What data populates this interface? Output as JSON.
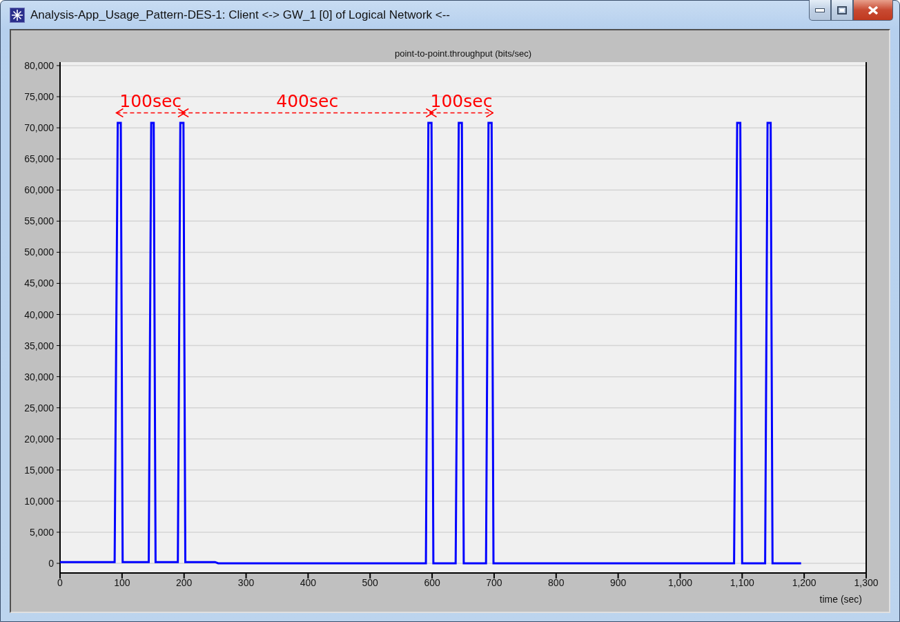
{
  "window": {
    "title": "Analysis-App_Usage_Pattern-DES-1: Client <-> GW_1 [0] of Logical Network <--"
  },
  "chart": {
    "chart_data": {
      "type": "line",
      "title": "point-to-point.throughput (bits/sec)",
      "xlabel": "time (sec)",
      "x": [
        0,
        88,
        93,
        98,
        101,
        143,
        147,
        151,
        154,
        190,
        194,
        199,
        202,
        250,
        255,
        590,
        594,
        599,
        602,
        638,
        643,
        648,
        651,
        687,
        691,
        696,
        699,
        1087,
        1092,
        1097,
        1100,
        1137,
        1141,
        1146,
        1149,
        1195
      ],
      "grid": true,
      "series": [
        {
          "color": "#0000ff",
          "values": [
            200,
            200,
            70800,
            70800,
            200,
            200,
            70800,
            70800,
            200,
            200,
            70800,
            70800,
            200,
            200,
            0,
            0,
            70800,
            70800,
            0,
            0,
            70800,
            70800,
            0,
            0,
            70800,
            70800,
            0,
            0,
            70800,
            70800,
            0,
            0,
            70800,
            70800,
            0,
            0
          ]
        }
      ],
      "xlim": [
        0,
        1300
      ],
      "ylim": [
        0,
        80000
      ],
      "xticks": [
        {
          "value": 0,
          "label": "0"
        },
        {
          "value": 100,
          "label": "100"
        },
        {
          "value": 200,
          "label": "200"
        },
        {
          "value": 300,
          "label": "300"
        },
        {
          "value": 400,
          "label": "400"
        },
        {
          "value": 500,
          "label": "500"
        },
        {
          "value": 600,
          "label": "600"
        },
        {
          "value": 700,
          "label": "700"
        },
        {
          "value": 800,
          "label": "800"
        },
        {
          "value": 900,
          "label": "900"
        },
        {
          "value": 1000,
          "label": "1,000"
        },
        {
          "value": 1100,
          "label": "1,100"
        },
        {
          "value": 1200,
          "label": "1,200"
        },
        {
          "value": 1300,
          "label": "1,300"
        }
      ],
      "yticks": [
        {
          "value": 0,
          "label": "0"
        },
        {
          "value": 5000,
          "label": "5,000"
        },
        {
          "value": 10000,
          "label": "10,000"
        },
        {
          "value": 15000,
          "label": "15,000"
        },
        {
          "value": 20000,
          "label": "20,000"
        },
        {
          "value": 25000,
          "label": "25,000"
        },
        {
          "value": 30000,
          "label": "30,000"
        },
        {
          "value": 35000,
          "label": "35,000"
        },
        {
          "value": 40000,
          "label": "40,000"
        },
        {
          "value": 45000,
          "label": "45,000"
        },
        {
          "value": 50000,
          "label": "50,000"
        },
        {
          "value": 55000,
          "label": "55,000"
        },
        {
          "value": 60000,
          "label": "60,000"
        },
        {
          "value": 65000,
          "label": "65,000"
        },
        {
          "value": 70000,
          "label": "70,000"
        },
        {
          "value": 75000,
          "label": "75,000"
        },
        {
          "value": 80000,
          "label": "80,000"
        }
      ],
      "annotations": [
        "100sec",
        "400sec",
        "100sec"
      ]
    }
  }
}
